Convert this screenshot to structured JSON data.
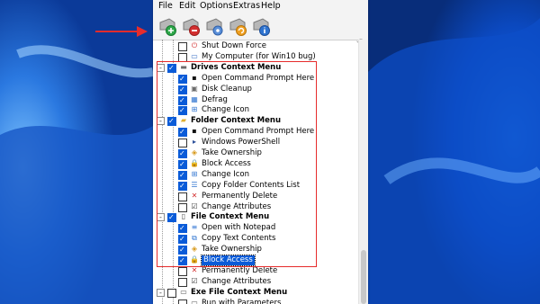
{
  "menu": [
    "File",
    "Edit",
    "Options",
    "Extras",
    "Help"
  ],
  "toolbar_icons": [
    "add-item-icon",
    "remove-item-icon",
    "settings-icon",
    "refresh-icon",
    "info-icon"
  ],
  "tree": [
    {
      "label": "Shut Down Force",
      "level": 2,
      "checked": false,
      "icon": "power-icon",
      "bold": false
    },
    {
      "label": "My Computer (for Win10 bug)",
      "level": 2,
      "checked": false,
      "icon": "computer-icon",
      "bold": false
    },
    {
      "label": "Drives Context Menu",
      "level": 1,
      "checked": true,
      "icon": "drive-icon",
      "bold": true,
      "expander": "-"
    },
    {
      "label": "Open Command Prompt Here",
      "level": 2,
      "checked": true,
      "icon": "cmd-icon",
      "bold": false
    },
    {
      "label": "Disk Cleanup",
      "level": 2,
      "checked": true,
      "icon": "disk-cleanup-icon",
      "bold": false
    },
    {
      "label": "Defrag",
      "level": 2,
      "checked": true,
      "icon": "defrag-icon",
      "bold": false
    },
    {
      "label": "Change Icon",
      "level": 2,
      "checked": true,
      "icon": "windows-icon",
      "bold": false
    },
    {
      "label": "Folder Context Menu",
      "level": 1,
      "checked": true,
      "icon": "folder-icon",
      "bold": true,
      "expander": "-"
    },
    {
      "label": "Open Command Prompt Here",
      "level": 2,
      "checked": true,
      "icon": "cmd-icon",
      "bold": false
    },
    {
      "label": "Windows PowerShell",
      "level": 2,
      "checked": false,
      "icon": "powershell-icon",
      "bold": false
    },
    {
      "label": "Take Ownership",
      "level": 2,
      "checked": true,
      "icon": "shield-icon",
      "bold": false
    },
    {
      "label": "Block Access",
      "level": 2,
      "checked": true,
      "icon": "lock-icon",
      "bold": false
    },
    {
      "label": "Change Icon",
      "level": 2,
      "checked": true,
      "icon": "windows-icon",
      "bold": false
    },
    {
      "label": "Copy Folder Contents List",
      "level": 2,
      "checked": true,
      "icon": "copy-list-icon",
      "bold": false
    },
    {
      "label": "Permanently Delete",
      "level": 2,
      "checked": false,
      "icon": "delete-x-icon",
      "bold": false
    },
    {
      "label": "Change Attributes",
      "level": 2,
      "checked": false,
      "icon": "attributes-icon",
      "bold": false
    },
    {
      "label": "File Context Menu",
      "level": 1,
      "checked": true,
      "icon": "file-icon",
      "bold": true,
      "expander": "-"
    },
    {
      "label": "Open with Notepad",
      "level": 2,
      "checked": true,
      "icon": "notepad-icon",
      "bold": false
    },
    {
      "label": "Copy Text Contents",
      "level": 2,
      "checked": true,
      "icon": "copy-text-icon",
      "bold": false
    },
    {
      "label": "Take Ownership",
      "level": 2,
      "checked": true,
      "icon": "shield-icon",
      "bold": false
    },
    {
      "label": "Block Access",
      "level": 2,
      "checked": true,
      "icon": "lock-icon",
      "bold": false,
      "selected": true
    },
    {
      "label": "Permanently Delete",
      "level": 2,
      "checked": false,
      "icon": "delete-x-icon",
      "bold": false
    },
    {
      "label": "Change Attributes",
      "level": 2,
      "checked": false,
      "icon": "attributes-icon",
      "bold": false
    },
    {
      "label": "Exe File Context Menu",
      "level": 1,
      "checked": false,
      "icon": "exe-icon",
      "bold": true,
      "expander": "-"
    },
    {
      "label": "Run with Parameters",
      "level": 2,
      "checked": false,
      "icon": "exe-icon",
      "bold": false
    }
  ],
  "colors": {
    "highlight_box": "#e62c2c",
    "arrow": "#e62c2c",
    "selection": "#0a5bd8",
    "desktop": "#0a3f9e"
  }
}
